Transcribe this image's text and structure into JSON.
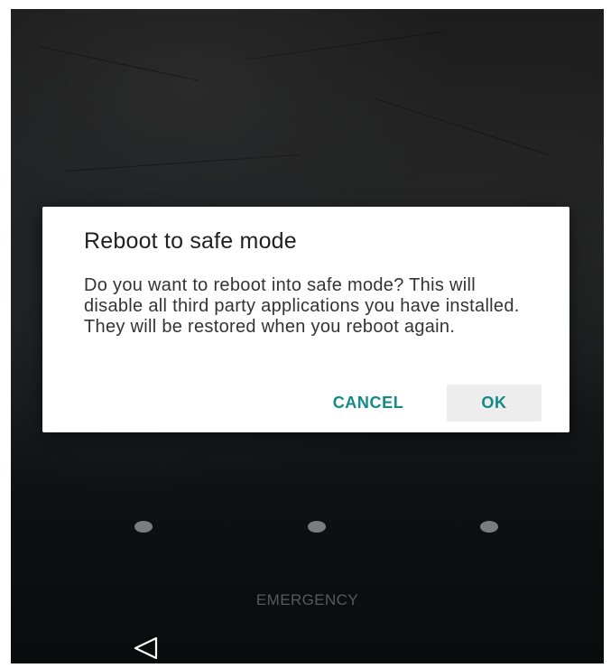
{
  "dialog": {
    "title": "Reboot to safe mode",
    "message": "Do you want to reboot into safe mode? This will disable all third party applications you have installed. They will be restored when you reboot again.",
    "cancel_label": "CANCEL",
    "ok_label": "OK"
  },
  "lockscreen": {
    "pattern_dots": 3,
    "emergency_label": "EMERGENCY"
  },
  "navbar": {
    "back_icon": "back-triangle-icon"
  },
  "colors": {
    "accent": "#138a86",
    "dialog_bg": "#ffffff",
    "ok_button_bg": "#ededed"
  }
}
